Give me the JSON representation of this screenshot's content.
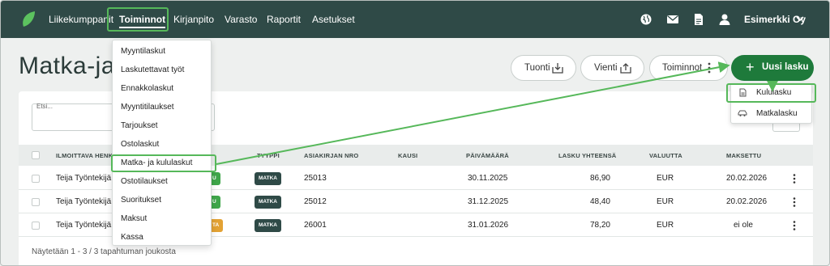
{
  "nav": {
    "items": [
      "Liikekumppanit",
      "Toiminnot",
      "Kirjanpito",
      "Varasto",
      "Raportit",
      "Asetukset"
    ],
    "active": "Toiminnot",
    "icons": [
      "globe-icon",
      "mail-icon",
      "document-icon",
      "user-icon"
    ],
    "company": "Esimerkki Oy"
  },
  "page": {
    "title": "Matka-ja kulut",
    "buttons": {
      "import": "Tuonti",
      "export": "Vienti",
      "actions": "Toiminnot",
      "new_invoice": "Uusi lasku"
    },
    "search_label": "Etsi..."
  },
  "menu": {
    "items": [
      "Myyntilaskut",
      "Laskutettavat työt",
      "Ennakkolaskut",
      "Myyntitilaukset",
      "Tarjoukset",
      "Ostolaskut",
      "Matka- ja kululaskut",
      "Ostotilaukset",
      "Suoritukset",
      "Maksut",
      "Kassa"
    ],
    "highlighted": "Matka- ja kululaskut"
  },
  "new_menu": {
    "items": [
      "Kululasku",
      "Matkalasku"
    ],
    "highlighted": "Kululasku"
  },
  "table": {
    "headers": {
      "reporter": "ILMOITTAVA HENKILÖ",
      "type": "TYYPPI",
      "doc_no": "ASIAKIRJAN NRO",
      "period": "KAUSI",
      "date": "PÄIVÄMÄÄRÄ",
      "total": "LASKU YHTEENSÄ",
      "currency": "VALUUTTA",
      "paid": "MAKSETTU"
    },
    "rows": [
      {
        "reporter": "Teija Työntekijä",
        "status": "U",
        "type": "MATKA",
        "doc_no": "25013",
        "period": "",
        "date": "30.11.2025",
        "total": "86,90",
        "currency": "EUR",
        "paid": "20.02.2026"
      },
      {
        "reporter": "Teija Työntekijä",
        "status": "U",
        "type": "MATKA",
        "doc_no": "25012",
        "period": "",
        "date": "31.12.2025",
        "total": "48,40",
        "currency": "EUR",
        "paid": "20.02.2026"
      },
      {
        "reporter": "Teija Työntekijä",
        "status": "TA",
        "type": "MATKA",
        "doc_no": "26001",
        "period": "",
        "date": "31.01.2026",
        "total": "78,20",
        "currency": "EUR",
        "paid": "ei ole"
      }
    ],
    "footer": "Näytetään 1 - 3 / 3 tapahtuman joukosta"
  },
  "colors": {
    "topbar": "#2f4a47",
    "primary": "#1e7a3b",
    "highlight": "#56b85a",
    "badge_type": "#2f4a47",
    "badge_green": "#3fa64a",
    "badge_orange": "#e3a234"
  }
}
